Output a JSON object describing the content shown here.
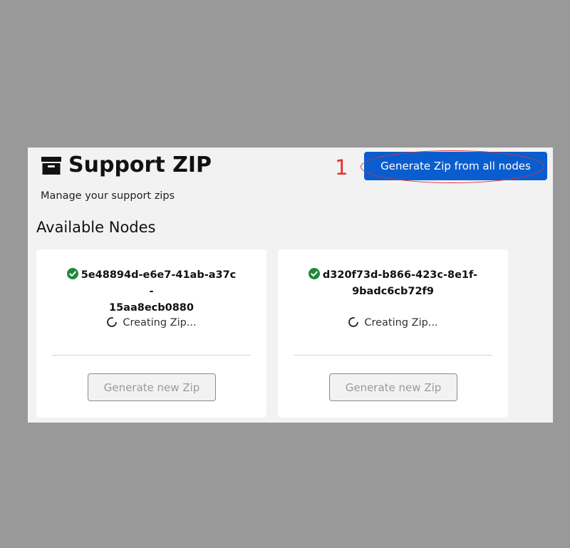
{
  "header": {
    "title": "Support ZIP",
    "title_icon": "archive-box-icon",
    "subtitle": "Manage your support zips",
    "generate_all_label": "Generate Zip from all nodes",
    "annotation_number": "1"
  },
  "section": {
    "heading": "Available Nodes"
  },
  "nodes": [
    {
      "id_line1": "5e48894d-e6e7-41ab-a37c-",
      "id_line2": "15aa8ecb0880",
      "status_icon": "check-circle-icon",
      "status_text": "Creating Zip...",
      "button_label": "Generate new Zip"
    },
    {
      "id_line1": "d320f73d-b866-423c-8e1f-",
      "id_line2": "9badc6cb72f9",
      "status_icon": "check-circle-icon",
      "status_text": "Creating Zip...",
      "button_label": "Generate new Zip"
    }
  ],
  "colors": {
    "accent": "#0a5dcf",
    "annotation": "#e5302f",
    "success": "#1e8a3c"
  }
}
